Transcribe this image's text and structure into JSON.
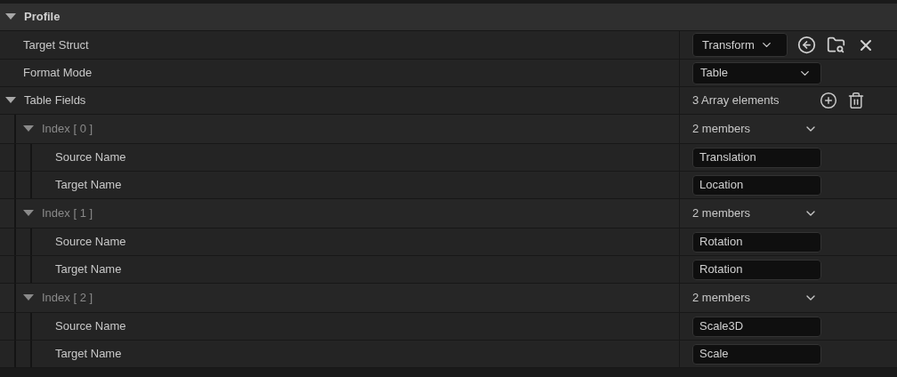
{
  "section": {
    "title": "Profile",
    "expanded": true
  },
  "properties": [
    {
      "kind": "struct-picker",
      "label": "Target Struct",
      "value": "Transform"
    },
    {
      "kind": "combo",
      "label": "Format Mode",
      "value": "Table"
    },
    {
      "kind": "array",
      "label": "Table Fields",
      "expanded": true,
      "summary": "3 Array elements",
      "elements": [
        {
          "label": "Index [ 0 ]",
          "expanded": true,
          "summary": "2 members",
          "fields": [
            {
              "label": "Source Name",
              "value": "Translation"
            },
            {
              "label": "Target Name",
              "value": "Location"
            }
          ]
        },
        {
          "label": "Index [ 1 ]",
          "expanded": true,
          "summary": "2 members",
          "fields": [
            {
              "label": "Source Name",
              "value": "Rotation"
            },
            {
              "label": "Target Name",
              "value": "Rotation"
            }
          ]
        },
        {
          "label": "Index [ 2 ]",
          "expanded": true,
          "summary": "2 members",
          "fields": [
            {
              "label": "Source Name",
              "value": "Scale3D"
            },
            {
              "label": "Target Name",
              "value": "Scale"
            }
          ]
        }
      ]
    }
  ]
}
